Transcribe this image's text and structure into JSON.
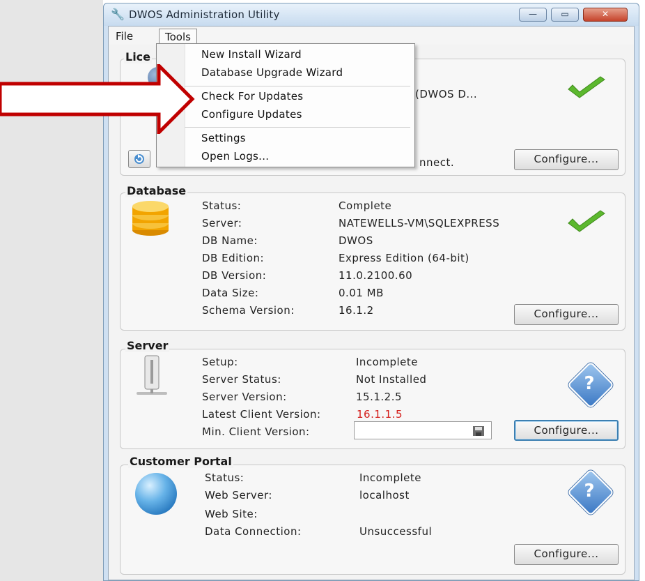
{
  "window": {
    "title": "DWOS Administration Utility",
    "minimize": "—",
    "maximize": "▭",
    "close": "✕"
  },
  "menubar": {
    "file": "File",
    "tools": "Tools"
  },
  "tools_menu": {
    "items": [
      "New Install Wizard",
      "Database Upgrade Wizard",
      "Check For Updates",
      "Configure Updates",
      "Settings",
      "Open Logs..."
    ]
  },
  "license": {
    "title_partial": "Lice",
    "server_partial": "(DWOS D...",
    "connect_partial": "nnect.",
    "configure": "Configure..."
  },
  "database": {
    "title": "Database",
    "rows": [
      {
        "label": "Status:",
        "value": "Complete"
      },
      {
        "label": "Server:",
        "value": "NATEWELLS-VM\\SQLEXPRESS"
      },
      {
        "label": "DB Name:",
        "value": "DWOS"
      },
      {
        "label": "DB Edition:",
        "value": "Express Edition (64-bit)"
      },
      {
        "label": "DB Version:",
        "value": "11.0.2100.60"
      },
      {
        "label": "Data Size:",
        "value": "0.01 MB"
      },
      {
        "label": "Schema Version:",
        "value": "16.1.2"
      }
    ],
    "configure": "Configure..."
  },
  "server": {
    "title": "Server",
    "rows": [
      {
        "label": "Setup:",
        "value": "Incomplete"
      },
      {
        "label": "Server Status:",
        "value": "Not Installed"
      },
      {
        "label": "Server Version:",
        "value": "15.1.2.5"
      },
      {
        "label": "Latest Client Version:",
        "value": "16.1.1.5"
      },
      {
        "label": "Min. Client Version:",
        "value": ""
      }
    ],
    "configure": "Configure...",
    "question": "?"
  },
  "portal": {
    "title": "Customer Portal",
    "rows": [
      {
        "label": "Status:",
        "value": "Incomplete"
      },
      {
        "label": "Web Server:",
        "value": "localhost"
      },
      {
        "label": "Web Site:",
        "value": ""
      },
      {
        "label": "Data Connection:",
        "value": "Unsuccessful"
      }
    ],
    "configure": "Configure...",
    "question": "?"
  },
  "colors": {
    "arrow": "#c00000",
    "accent_red": "#d4201d",
    "check_green": "#5cb82e"
  }
}
